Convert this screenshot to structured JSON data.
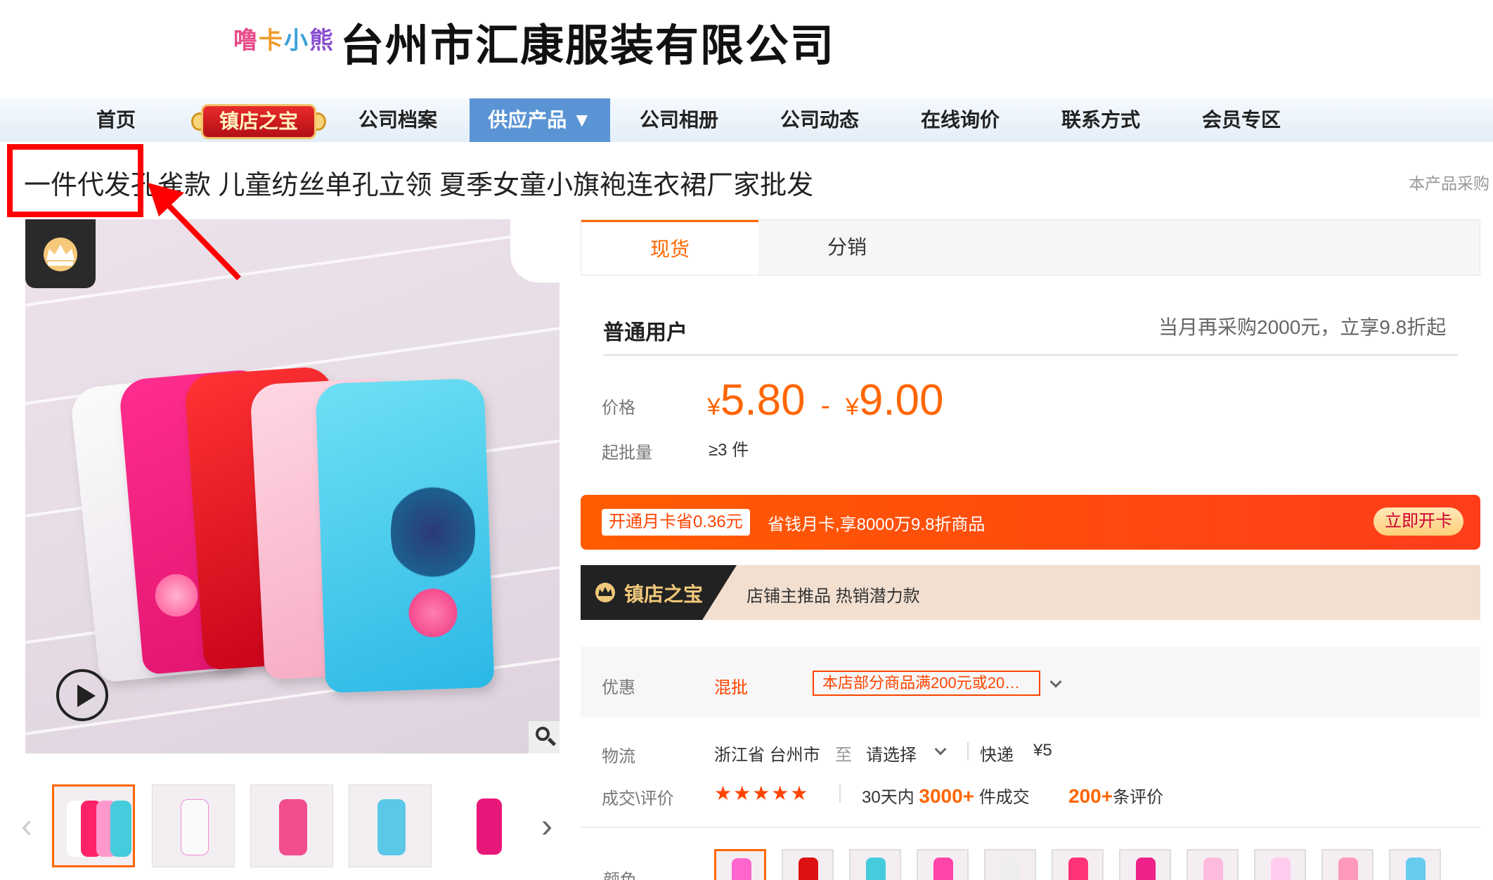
{
  "header": {
    "brand_chars": [
      "噜",
      "卡",
      "小",
      "熊"
    ],
    "brand_colors": [
      "#e84c8a",
      "#f19a2a",
      "#3aa0d8",
      "#8a4fd0"
    ],
    "company_name": "台州市汇康服装有限公司"
  },
  "nav": {
    "items": [
      "首页",
      "镇店之宝",
      "公司档案",
      "供应产品 ▼",
      "公司相册",
      "公司动态",
      "在线询价",
      "联系方式",
      "会员专区"
    ]
  },
  "product": {
    "title": "一件代发孔雀款 儿童纺丝单孔立领 夏季女童小旗袍连衣裙厂家批发",
    "title_right": "本产品采购"
  },
  "tabs": [
    "现货",
    "分销"
  ],
  "pricing": {
    "user_type": "普通用户",
    "user_promo": "当月再采购2000元，立享9.8折起",
    "price_label": "价格",
    "currency": "¥",
    "price_low": "5.80",
    "price_sep": "-",
    "price_high": "9.00",
    "moq_label": "起批量",
    "moq_value": "≥3 件"
  },
  "member_card": {
    "tag": "开通月卡省0.36元",
    "text": "省钱月卡,享8000万9.8折商品",
    "button": "立即开卡"
  },
  "treasure": {
    "label": "镇店之宝",
    "desc": "店铺主推品  热销潜力款"
  },
  "discount": {
    "label": "优惠",
    "mix": "混批",
    "coupon": "本店部分商品满200元或20…"
  },
  "shipping": {
    "label": "物流",
    "origin": "浙江省 台州市",
    "to": "至",
    "destination": "请选择",
    "method": "快递",
    "fee": "¥5"
  },
  "rating": {
    "label": "成交\\评价",
    "stars": "★★★★★",
    "deal_prefix": "30天内",
    "deal_count": "3000+",
    "deal_suffix": "件成交",
    "review_count": "200+",
    "review_suffix": "条评价"
  },
  "options": {
    "color_label": "颜色"
  },
  "colors": {
    "accent": "#ff6600",
    "nav_active": "#5b94d5",
    "highlight": "#ff0000"
  }
}
